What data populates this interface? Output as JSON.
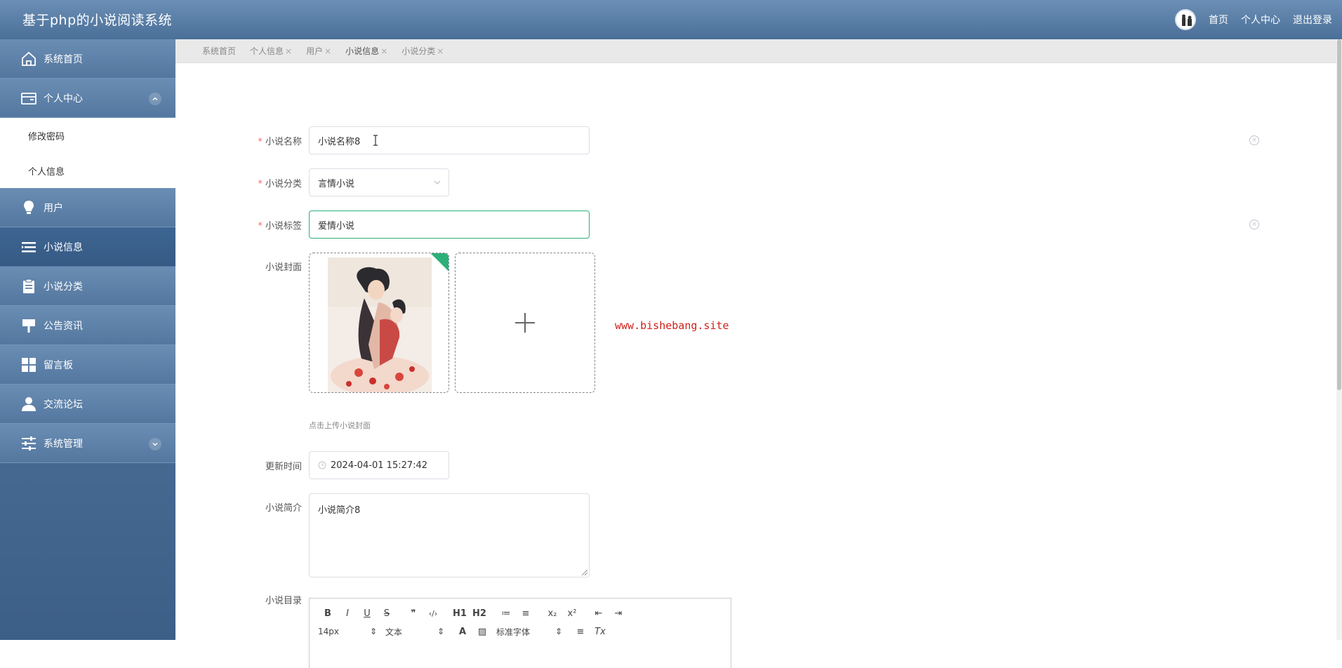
{
  "app": {
    "title": "基于php的小说阅读系统"
  },
  "header": {
    "home": "首页",
    "profile": "个人中心",
    "logout": "退出登录"
  },
  "sidebar": {
    "items": [
      {
        "label": "系统首页",
        "icon": "home-icon"
      },
      {
        "label": "个人中心",
        "icon": "wallet-icon",
        "expanded": true,
        "children": [
          {
            "label": "修改密码"
          },
          {
            "label": "个人信息"
          }
        ]
      },
      {
        "label": "用户",
        "icon": "lightbulb-icon"
      },
      {
        "label": "小说信息",
        "icon": "list-icon",
        "active": true
      },
      {
        "label": "小说分类",
        "icon": "clipboard-icon"
      },
      {
        "label": "公告资讯",
        "icon": "signpost-icon"
      },
      {
        "label": "留言板",
        "icon": "grid-icon"
      },
      {
        "label": "交流论坛",
        "icon": "person-icon"
      },
      {
        "label": "系统管理",
        "icon": "sliders-icon",
        "expandable": true
      }
    ]
  },
  "tabs": [
    {
      "label": "系统首页",
      "close": ""
    },
    {
      "label": "个人信息",
      "close": "×"
    },
    {
      "label": "用户",
      "close": "×"
    },
    {
      "label": "小说信息",
      "close": "×",
      "active": true
    },
    {
      "label": "小说分类",
      "close": "×"
    }
  ],
  "form": {
    "name": {
      "label": "小说名称",
      "value": "小说名称8"
    },
    "category": {
      "label": "小说分类",
      "value": "言情小说"
    },
    "tags": {
      "label": "小说标签",
      "value": "爱情小说"
    },
    "cover": {
      "label": "小说封面",
      "hint": "点击上传小说封面"
    },
    "updated": {
      "label": "更新时间",
      "value": "2024-04-01 15:27:42"
    },
    "intro": {
      "label": "小说简介",
      "value": "小说简介8"
    },
    "catalog": {
      "label": "小说目录"
    },
    "required_mark": "*"
  },
  "editor": {
    "row1": [
      "B",
      "I",
      "U",
      "S",
      "❞",
      "‹/›",
      "H1",
      "H2",
      "≔",
      "≡",
      "x₂",
      "x²",
      "⇤",
      "⇥"
    ],
    "font_size": "14px",
    "text_type": "文本",
    "font_family": "标准字体"
  },
  "watermark": "www.bishebang.site",
  "colors": {
    "header": "#5b7fa8",
    "active_nav": "#3e6592",
    "focus": "#2bb07a",
    "required": "#f56c6c",
    "watermark": "#d0201b"
  }
}
